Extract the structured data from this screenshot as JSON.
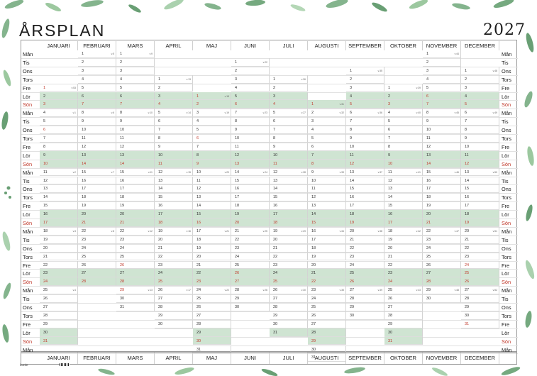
{
  "title": "ÅRSPLAN",
  "year": "2027",
  "brand": "burde",
  "months": [
    "JANUARI",
    "FEBRUARI",
    "MARS",
    "APRIL",
    "MAJ",
    "JUNI",
    "JULI",
    "AUGUSTI",
    "SEPTEMBER",
    "OKTOBER",
    "NOVEMBER",
    "DECEMBER"
  ],
  "weekdays": [
    "Mån",
    "Tis",
    "Ons",
    "Tors",
    "Fre",
    "Lör",
    "Sön"
  ],
  "month_lengths": [
    31,
    28,
    31,
    30,
    31,
    30,
    31,
    31,
    30,
    31,
    30,
    31
  ],
  "month_start_weekday": [
    4,
    0,
    0,
    3,
    5,
    1,
    3,
    6,
    2,
    4,
    0,
    2
  ],
  "sunday_color": "#c0392b",
  "weekend_tint": "#cfe4d2",
  "holidays": [
    [
      1,
      1
    ],
    [
      1,
      6
    ],
    [
      3,
      26
    ],
    [
      3,
      28
    ],
    [
      3,
      29
    ],
    [
      5,
      1
    ],
    [
      5,
      6
    ],
    [
      5,
      16
    ],
    [
      6,
      6
    ],
    [
      6,
      26
    ],
    [
      11,
      6
    ],
    [
      12,
      24
    ],
    [
      12,
      25
    ],
    [
      12,
      26
    ],
    [
      12,
      31
    ]
  ],
  "week_numbers": {
    "1": [
      53,
      1,
      2,
      3,
      4,
      5
    ],
    "2": [
      5,
      6,
      7,
      8,
      9
    ],
    "3": [
      9,
      10,
      11,
      12,
      13
    ],
    "4": [
      13,
      14,
      15,
      16,
      17,
      18
    ],
    "5": [
      18,
      19,
      20,
      21,
      22
    ],
    "6": [
      22,
      23,
      24,
      25,
      26
    ],
    "7": [
      26,
      27,
      28,
      29,
      30
    ],
    "8": [
      31,
      32,
      33,
      34,
      35
    ],
    "9": [
      35,
      36,
      37,
      38,
      39
    ],
    "10": [
      39,
      40,
      41,
      42,
      43,
      44
    ],
    "11": [
      44,
      45,
      46,
      47,
      48
    ],
    "12": [
      48,
      49,
      50,
      51,
      52
    ]
  }
}
